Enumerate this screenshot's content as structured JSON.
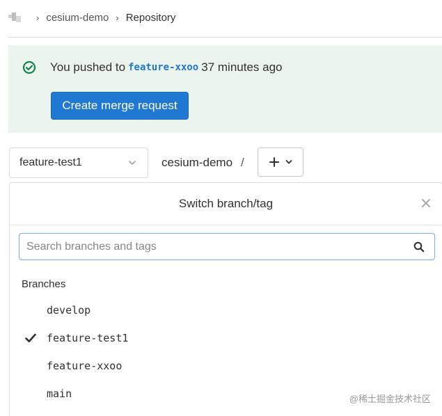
{
  "breadcrumb": {
    "project": "cesium-demo",
    "current": "Repository"
  },
  "alert": {
    "prefix": "You pushed to",
    "branch": "feature-xxoo",
    "suffix": "37 minutes ago",
    "button_label": "Create merge request",
    "accent_color": "#1f78d1",
    "success_color": "#108548"
  },
  "toolbar": {
    "selected_branch": "feature-test1",
    "path": "cesium-demo",
    "path_separator": "/"
  },
  "dropdown": {
    "title": "Switch branch/tag",
    "search_placeholder": "Search branches and tags",
    "section_title": "Branches",
    "branches": [
      {
        "name": "develop",
        "selected": false
      },
      {
        "name": "feature-test1",
        "selected": true
      },
      {
        "name": "feature-xxoo",
        "selected": false
      },
      {
        "name": "main",
        "selected": false
      }
    ]
  },
  "watermark": "@稀土掘金技术社区"
}
